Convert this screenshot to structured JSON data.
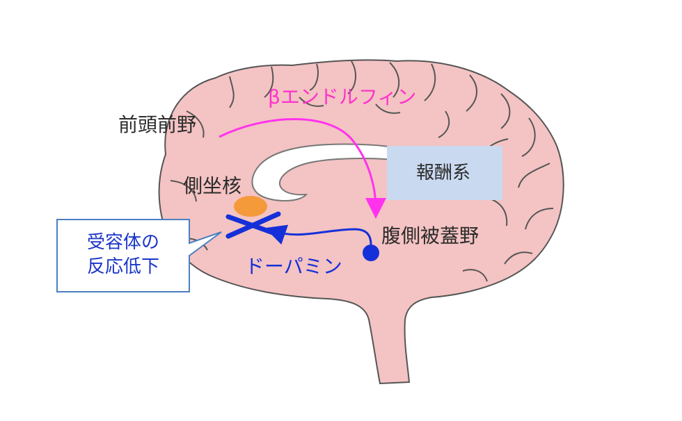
{
  "labels": {
    "prefrontal": "前頭前野",
    "accumbens": "側坐核",
    "vta": "腹側被蓋野",
    "reward": "報酬系",
    "endorphin": "βエンドルフィン",
    "dopamine": "ドーパミン",
    "callout_line1": "受容体の",
    "callout_line2": "反応低下"
  },
  "colors": {
    "brain_fill": "#f4c3c3",
    "brain_stroke": "#555555",
    "endorphin_arrow": "#ff33ee",
    "dopamine_arrow": "#1530d8",
    "accumbens_fill": "#f59a3b",
    "reward_box": "#c9daf0",
    "callout_border": "#4a7fc0"
  }
}
